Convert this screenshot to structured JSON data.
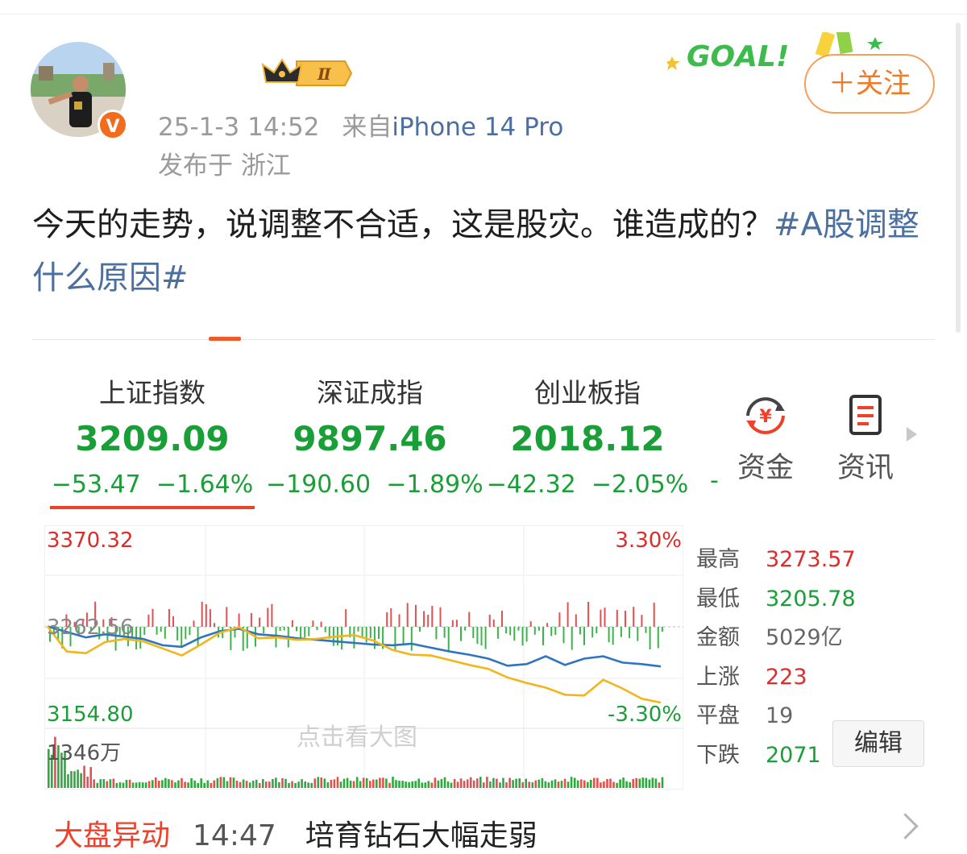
{
  "post": {
    "time": "25-1-3 14:52",
    "source_prefix": "来自",
    "source": "iPhone 14 Pro",
    "location": "发布于 浙江",
    "text": "今天的走势，说调整不合适，这是股灾。谁造成的？",
    "hashtag": "#A股调整什么原因#",
    "follow_label": "＋关注",
    "badge_text": "Ⅱ",
    "verified_mark": "V",
    "goal_text": "GOAL!"
  },
  "indices": [
    {
      "name": "上证指数",
      "value": "3209.09",
      "change": "−53.47",
      "pct": "−1.64%"
    },
    {
      "name": "深证成指",
      "value": "9897.46",
      "change": "−190.60",
      "pct": "−1.89%"
    },
    {
      "name": "创业板指",
      "value": "2018.12",
      "change": "−42.32",
      "pct": "−2.05%"
    }
  ],
  "index_overflow": "-",
  "tools": [
    {
      "label": "资金",
      "icon": "money-flow-icon",
      "icon_glyph": "¥"
    },
    {
      "label": "资讯",
      "icon": "news-doc-icon"
    }
  ],
  "chart": {
    "max_price": "3370.32",
    "min_price": "3154.80",
    "mid_price": "3262.56",
    "max_pct": "3.30%",
    "min_pct": "-3.30%",
    "volume_label": "1346万",
    "watermark": "点击看大图"
  },
  "chart_data": {
    "type": "line",
    "ylim": [
      3154.8,
      3370.32
    ],
    "series": [
      {
        "values": [
          3262,
          3255,
          3248,
          3252,
          3249,
          3246,
          3238,
          3236,
          3248,
          3256,
          3259,
          3252,
          3250,
          3247,
          3245,
          3243,
          3241,
          3239,
          3238,
          3240,
          3235,
          3230,
          3226,
          3221,
          3212,
          3214,
          3224,
          3213,
          3221,
          3224,
          3216,
          3214,
          3211
        ]
      },
      {
        "values": [
          3262,
          3230,
          3228,
          3242,
          3246,
          3243,
          3234,
          3225,
          3239,
          3254,
          3261,
          3247,
          3248,
          3245,
          3246,
          3249,
          3251,
          3244,
          3232,
          3226,
          3225,
          3219,
          3213,
          3208,
          3197,
          3190,
          3184,
          3175,
          3174,
          3194,
          3183,
          3170,
          3165
        ]
      }
    ]
  },
  "stats": [
    {
      "label": "最高",
      "value": "3273.57",
      "color": "#e02b2b"
    },
    {
      "label": "最低",
      "value": "3205.78",
      "color": "#1a9e37"
    },
    {
      "label": "金额",
      "value": "5029亿",
      "color": "#666666"
    },
    {
      "label": "上涨",
      "value": "223",
      "color": "#e02b2b"
    },
    {
      "label": "平盘",
      "value": "19",
      "color": "#666666"
    },
    {
      "label": "下跌",
      "value": "2071",
      "color": "#1a9e37"
    }
  ],
  "edit_label": "编辑",
  "news": {
    "tag": "大盘异动",
    "time": "14:47",
    "title": "培育钻石大幅走弱"
  },
  "colors": {
    "up": "#e02b2b",
    "down": "#1a9e37",
    "accent": "#f05a28",
    "link": "#4a6fa0"
  }
}
